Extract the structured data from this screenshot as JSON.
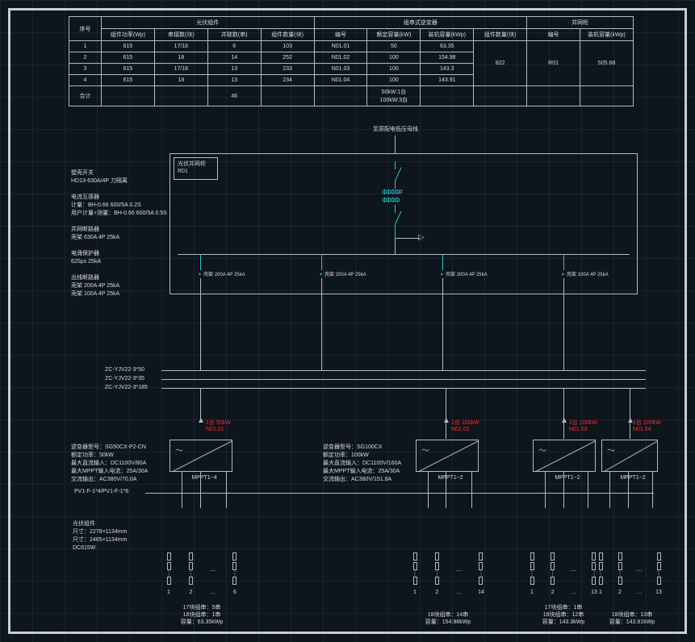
{
  "top_legend": "至原配电低压母线",
  "cabinet": {
    "line1": "光伏并网柜",
    "line2": "R01"
  },
  "panel_spec": {
    "l1": "塑壳开关",
    "l2": "HD13-630A/4P 刀隔离",
    "l3": "电流互感器",
    "l4": "计量：BH-0.66 600/5A 0.2S",
    "l5": "用户计量+测量：BH-0.66 600/5A 0.5S",
    "l6": "并网断路器",
    "l7": "壳架 630A 4P 25kA",
    "l8": "电涌保护器",
    "l9": "620μs 25kA",
    "l10": "出线断路器",
    "l11": "壳架 200A 4P 25kA",
    "l12": "壳架 100A 4P 25kA"
  },
  "breakers": [
    "壳架 200A 4P 25kA",
    "壳架 200A 4P 25kA",
    "壳架 200A 4P 25kA",
    "壳架 100A 4P 25kA"
  ],
  "cable_labels": {
    "l1": "ZC-YJV22-3*50",
    "l2": "ZC-YJV22-3*35",
    "l3": "ZC-YJV22-3*185"
  },
  "inv_spec_main": {
    "l1": "逆变器型号：SG50CX-P2-CN",
    "l2": "额定功率：50kW",
    "l3": "最大直流输入：DC1100V/80A",
    "l4": "最大MPPT输入电流：25A/30A",
    "l5": "交流输出：AC380V/70.0A"
  },
  "inv_spec_100": {
    "l1": "逆变器型号：SG100CX",
    "l2": "额定功率：100kW",
    "l3": "最大直流输入：DC1100V/160A",
    "l4": "最大MPPT输入电流：25A/30A",
    "l5": "交流输出：AC380V/151.8A"
  },
  "module_spec": {
    "l1": "光伏组件",
    "l2": "尺寸：2278×1134mm",
    "l3": "尺寸：2465×1134mm",
    "l4": "DC615W"
  },
  "inverters": [
    {
      "tag": "1台 50kW",
      "id": "N01.01",
      "mppt": "MPPT1~4"
    },
    {
      "tag": "1台 100kW",
      "id": "N01.02",
      "mppt": "MPPT1~2"
    },
    {
      "tag": "1台 100kW",
      "id": "N01.03",
      "mppt": "MPPT1~2"
    },
    {
      "tag": "1台 100kW",
      "id": "N01.04",
      "mppt": "MPPT1~2"
    }
  ],
  "pv_cable": "PV1-F-1*4/PV1-F-1*6",
  "strings": [
    {
      "cols": [
        "1",
        "2",
        "…",
        "6"
      ],
      "summary": "17块组串：5串\n18块组串：1串\n容量：63.35kWp"
    },
    {
      "cols": [
        "1",
        "2",
        "…",
        "14"
      ],
      "summary": "18块组串：14串\n容量：154.98kWp"
    },
    {
      "cols": [
        "1",
        "2",
        "…",
        "13"
      ],
      "summary": "17块组串：1串\n18块组串：12串\n容量：143.3kWp"
    },
    {
      "cols": [
        "1",
        "2",
        "…",
        "13"
      ],
      "summary": "18块组串：13串\n容量：143.91kWp"
    }
  ],
  "table": {
    "hdr_seq": "序号",
    "grp_module": "光伏组件",
    "grp_inverter": "组串式逆变器",
    "grp_cabinet": "并网柜",
    "cols_module": [
      "组件功率(Wp)",
      "串接数(块)",
      "并联数(串)",
      "组件数量(块)"
    ],
    "cols_inverter": [
      "编号",
      "额定容量(kW)",
      "装机容量(kWp)",
      "组件数量(块)"
    ],
    "cols_cabinet": [
      "编号",
      "装机容量(kWp)"
    ],
    "rows": [
      [
        "1",
        "615",
        "17/18",
        "6",
        "103",
        "N01.01",
        "50",
        "63.35"
      ],
      [
        "2",
        "615",
        "18",
        "14",
        "252",
        "N01.02",
        "100",
        "154.98"
      ],
      [
        "3",
        "615",
        "17/18",
        "13",
        "233",
        "N01.03",
        "100",
        "143.3"
      ],
      [
        "4",
        "615",
        "18",
        "13",
        "234",
        "N01.04",
        "100",
        "143.91"
      ]
    ],
    "total_label": "合计",
    "total_strings": "46",
    "total_inverters": "50kW:1台\n100kW:3台",
    "total_modules": "822",
    "cab_id": "R01",
    "cab_cap": "505.68"
  }
}
